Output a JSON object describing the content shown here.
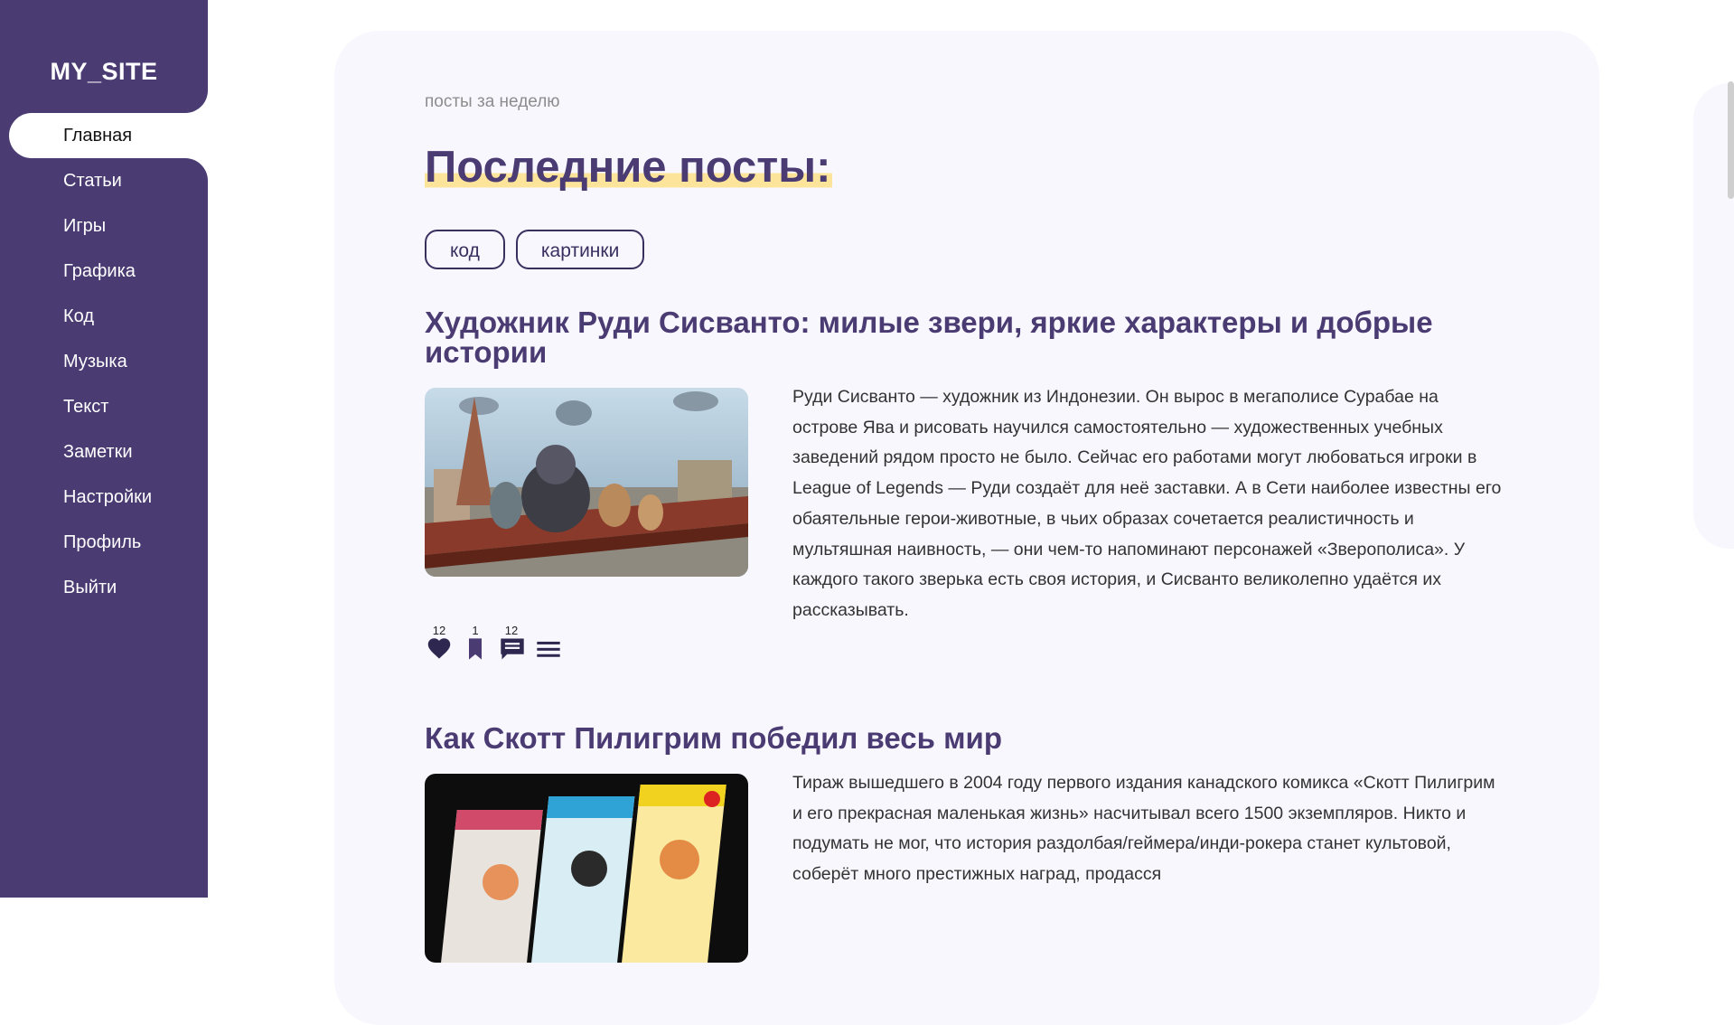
{
  "site": {
    "logo": "MY_SITE"
  },
  "nav": {
    "items": [
      {
        "label": "Главная",
        "active": true
      },
      {
        "label": "Статьи"
      },
      {
        "label": "Игры"
      },
      {
        "label": "Графика"
      },
      {
        "label": "Код"
      },
      {
        "label": "Музыка"
      },
      {
        "label": "Текст"
      },
      {
        "label": "Заметки"
      },
      {
        "label": "Настройки"
      },
      {
        "label": "Профиль"
      },
      {
        "label": "Выйти"
      }
    ]
  },
  "main": {
    "subtitle": "посты за неделю",
    "title": "Последние посты:",
    "tags": [
      "код",
      "картинки"
    ],
    "posts": [
      {
        "title": "Художник Руди Сисванто: милые звери, яркие характеры и добрые истории",
        "text": "Руди Сисванто — художник из Индонезии. Он вырос в мегаполисе Сурабае на острове Ява и рисовать научился самостоятельно — художественных учебных заведений рядом просто не было. Сейчас его работами могут любоваться игроки в League of Legends — Руди создаёт для неё заставки. А в Сети наиболее известны его обаятельные герои-животные, в чьих образах сочетается реалистичность и мультяшная наивность, — они чем-то напоминают персонажей «Зверополиса». У каждого такого зверька есть своя история, и Сисванто великолепно удаётся их рассказывать.",
        "likes": "12",
        "bookmarks": "1",
        "comments": "12"
      },
      {
        "title": "Как Скотт Пилигрим победил весь мир",
        "text": "Тираж вышедшего в 2004 году первого издания канадского комикса «Скотт Пилигрим и его прекрасная маленькая жизнь» насчитывал всего 1500 экземпляров. Никто и подумать не мог, что история раздолбая/геймера/инди-рокера станет культовой, соберёт много престижных наград, продасся"
      }
    ]
  },
  "colors": {
    "sidebar": "#4a3b73",
    "accent": "#4a3b73",
    "highlight": "#fde49b",
    "card_bg": "#f8f7fe"
  },
  "icons": {
    "like": "heart-icon",
    "bookmark": "bookmark-icon",
    "comment": "comment-icon",
    "menu": "menu-icon"
  }
}
